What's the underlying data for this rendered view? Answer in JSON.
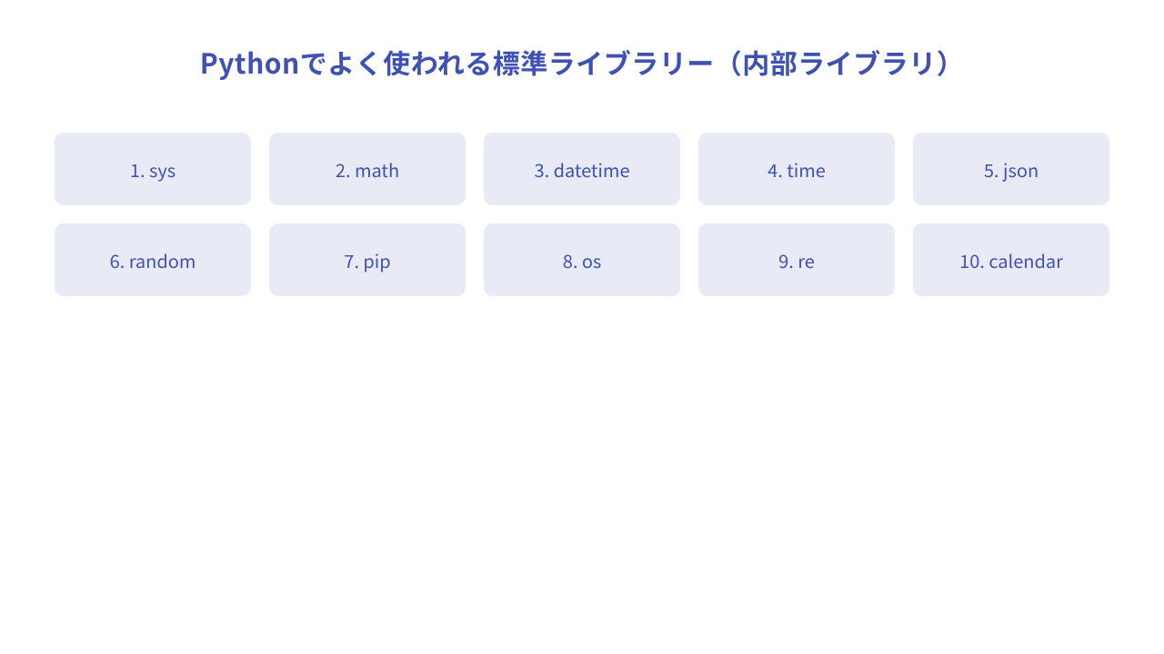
{
  "title": "Pythonでよく使われる標準ライブラリー（内部ライブラリ）",
  "cards": [
    {
      "label": "1. sys"
    },
    {
      "label": "2. math"
    },
    {
      "label": "3. datetime"
    },
    {
      "label": "4. time"
    },
    {
      "label": "5. json"
    },
    {
      "label": "6. random"
    },
    {
      "label": "7. pip"
    },
    {
      "label": "8. os"
    },
    {
      "label": "9. re"
    },
    {
      "label": "10. calendar"
    }
  ]
}
